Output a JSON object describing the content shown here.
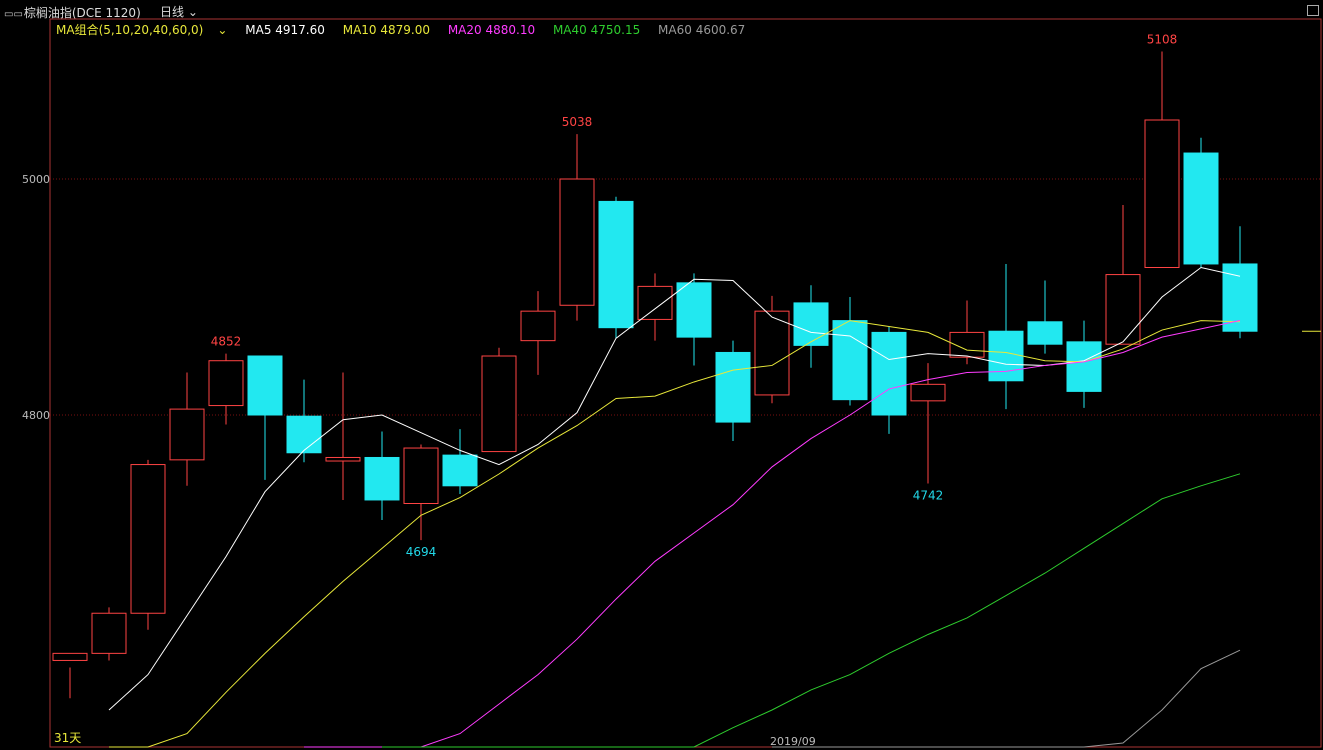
{
  "header": {
    "symbol": "棕榈油指(DCE 1120)",
    "period": "日线"
  },
  "ma_legend": {
    "combo": "MA组合(5,10,20,40,60,0)",
    "items": [
      {
        "label": "MA5 4917.60",
        "color": "#ffffff"
      },
      {
        "label": "MA10 4879.00",
        "color": "#e8e83a"
      },
      {
        "label": "MA20 4880.10",
        "color": "#ff3cff"
      },
      {
        "label": "MA40 4750.15",
        "color": "#2ecc2e"
      },
      {
        "label": "MA60 4600.67",
        "color": "#999999"
      }
    ]
  },
  "chart_data": {
    "type": "candlestick",
    "y_ticks": [
      "5000",
      "4800"
    ],
    "x_label": "2019/09",
    "annotations": [
      {
        "text": "4852",
        "value": 4852,
        "color": "#ff4444"
      },
      {
        "text": "4694",
        "value": 4694,
        "color": "#22d8e8"
      },
      {
        "text": "5038",
        "value": 5038,
        "color": "#ff4444"
      },
      {
        "text": "4742",
        "value": 4742,
        "color": "#22d8e8"
      },
      {
        "text": "5108",
        "value": 5108,
        "color": "#ff4444"
      }
    ],
    "bottom_marker": "31天",
    "candles": [
      [
        4592,
        4598,
        4586,
        4560
      ],
      [
        4598,
        4632,
        4637,
        4592
      ],
      [
        4632,
        4758,
        4762,
        4618
      ],
      [
        4762,
        4805,
        4836,
        4740
      ],
      [
        4808,
        4846,
        4852,
        4792
      ],
      [
        4850,
        4800,
        4850,
        4745
      ],
      [
        4799,
        4768,
        4830,
        4760
      ],
      [
        4761,
        4764,
        4836,
        4728
      ],
      [
        4764,
        4728,
        4786,
        4711
      ],
      [
        4725,
        4772,
        4775,
        4694
      ],
      [
        4766,
        4740,
        4788,
        4733
      ],
      [
        4769,
        4850,
        4857,
        4769
      ],
      [
        4863,
        4888,
        4905,
        4834
      ],
      [
        4893,
        5000,
        5038,
        4880
      ],
      [
        4981,
        4874,
        4985,
        4865
      ],
      [
        4881,
        4909,
        4920,
        4863
      ],
      [
        4912,
        4866,
        4920,
        4842
      ],
      [
        4853,
        4794,
        4863,
        4778
      ],
      [
        4817,
        4888,
        4901,
        4810
      ],
      [
        4895,
        4859,
        4910,
        4840
      ],
      [
        4880,
        4813,
        4900,
        4808
      ],
      [
        4870,
        4800,
        4875,
        4784
      ],
      [
        4812,
        4826,
        4844,
        4742
      ],
      [
        4849,
        4870,
        4897,
        4843
      ],
      [
        4871,
        4829,
        4928,
        4805
      ],
      [
        4879,
        4860,
        4914,
        4852
      ],
      [
        4862,
        4820,
        4880,
        4806
      ],
      [
        4860,
        4919,
        4978,
        4860
      ],
      [
        4925,
        5050,
        5108,
        4925
      ],
      [
        5022,
        4928,
        5035,
        4925
      ],
      [
        4928,
        4871,
        4960,
        4865
      ]
    ],
    "ma": {
      "MA5": [
        4550,
        4580,
        4630,
        4680,
        4735,
        4770,
        4796,
        4800,
        4785,
        4770,
        4758,
        4775,
        4802,
        4865,
        4890,
        4915,
        4914,
        4883,
        4870,
        4867,
        4847,
        4852,
        4850,
        4843,
        4842,
        4846,
        4862,
        4900,
        4925,
        4917.6
      ],
      "MA10": [
        4450,
        4490,
        4530,
        4565,
        4598,
        4629,
        4659,
        4687,
        4715,
        4730,
        4750,
        4772,
        4791,
        4814,
        4816,
        4828,
        4838,
        4842,
        4862,
        4880,
        4875,
        4870,
        4855,
        4853,
        4846,
        4845,
        4856,
        4872,
        4880,
        4879
      ],
      "MA20": [
        4420,
        4440,
        4470,
        4500,
        4530,
        4555,
        4580,
        4610,
        4644,
        4676,
        4700,
        4724,
        4756,
        4780,
        4800,
        4822,
        4830,
        4836,
        4837,
        4842,
        4845,
        4853,
        4866,
        4873,
        4880.1
      ],
      "MA40": [
        4400,
        4412,
        4425,
        4440,
        4455,
        4470,
        4485,
        4502,
        4518,
        4535,
        4550,
        4567,
        4580,
        4598,
        4614,
        4628,
        4647,
        4666,
        4687,
        4708,
        4729,
        4740,
        4750.15
      ],
      "MA60": [
        4398,
        4411,
        4424,
        4437,
        4450,
        4463,
        4475,
        4488,
        4500,
        4522,
        4550,
        4585,
        4600.67
      ]
    },
    "last_price_mark": 4871
  }
}
